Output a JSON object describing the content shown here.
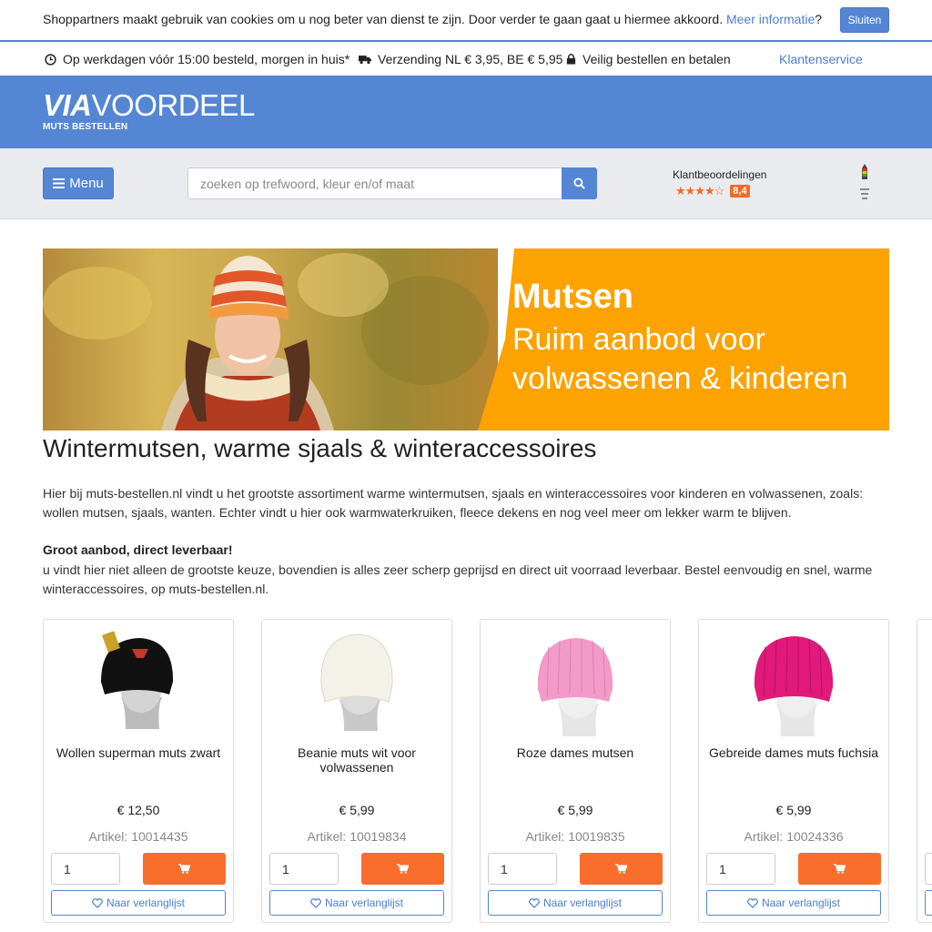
{
  "cookie": {
    "text": "Shoppartners maakt gebruik van cookies om u nog beter van dienst te zijn. Door verder te gaan gaat u hiermee akkoord.",
    "link": "Meer informatie",
    "suffix": "?",
    "close_label": "Sluiten"
  },
  "usp": {
    "delivery": "Op werkdagen vóór 15:00 besteld, morgen in huis*",
    "shipping": "Verzending NL € 3,95, BE € 5,95",
    "secure": "Veilig bestellen en betalen",
    "customer_service": "Klantenservice"
  },
  "header": {
    "logo_via": "VIA",
    "logo_rest": "VOORDEEL",
    "logo_sub": "MUTS BESTELLEN"
  },
  "nav": {
    "menu_label": "Menu",
    "search_placeholder": "zoeken op trefwoord, kleur en/of maat",
    "reviews_label": "Klantbeoordelingen",
    "stars": "★★★★☆",
    "rating": "8,4"
  },
  "banner": {
    "title": "Mutsen",
    "subtitle": "Ruim aanbod voor volwassenen & kinderen"
  },
  "content": {
    "heading": "Wintermutsen, warme sjaals & winteraccessoires",
    "intro": "Hier bij muts-bestellen.nl vindt u het grootste assortiment warme wintermutsen, sjaals en winteraccessoires voor kinderen en volwassenen, zoals: wollen mutsen, sjaals, wanten. Echter vindt u hier ook warmwaterkruiken, fleece dekens en nog veel meer om lekker warm te blijven.",
    "subheading": "Groot aanbod, direct leverbaar!",
    "intro2": "u vindt hier niet alleen de grootste keuze, bovendien is alles zeer scherp geprijsd en direct uit voorraad leverbaar. Bestel eenvoudig en snel, warme winteraccessoires, op muts-bestellen.nl."
  },
  "products": [
    {
      "name": "Wollen superman muts zwart",
      "price": "€ 12,50",
      "article": "Artikel: 10014435",
      "qty": "1",
      "wishlist": "Naar verlanglijst",
      "color": "#1a1a1a"
    },
    {
      "name": "Beanie muts wit voor volwassenen",
      "price": "€ 5,99",
      "article": "Artikel: 10019834",
      "qty": "1",
      "wishlist": "Naar verlanglijst",
      "color": "#f2f0e6"
    },
    {
      "name": "Roze dames mutsen",
      "price": "€ 5,99",
      "article": "Artikel: 10019835",
      "qty": "1",
      "wishlist": "Naar verlanglijst",
      "color": "#f29ac8"
    },
    {
      "name": "Gebreide dames muts fuchsia",
      "price": "€ 5,99",
      "article": "Artikel: 10024336",
      "qty": "1",
      "wishlist": "Naar verlanglijst",
      "color": "#e0197a"
    }
  ],
  "colors": {
    "brand_blue": "#5586d4",
    "accent_orange": "#f96d2d",
    "banner_orange": "#fca201"
  }
}
